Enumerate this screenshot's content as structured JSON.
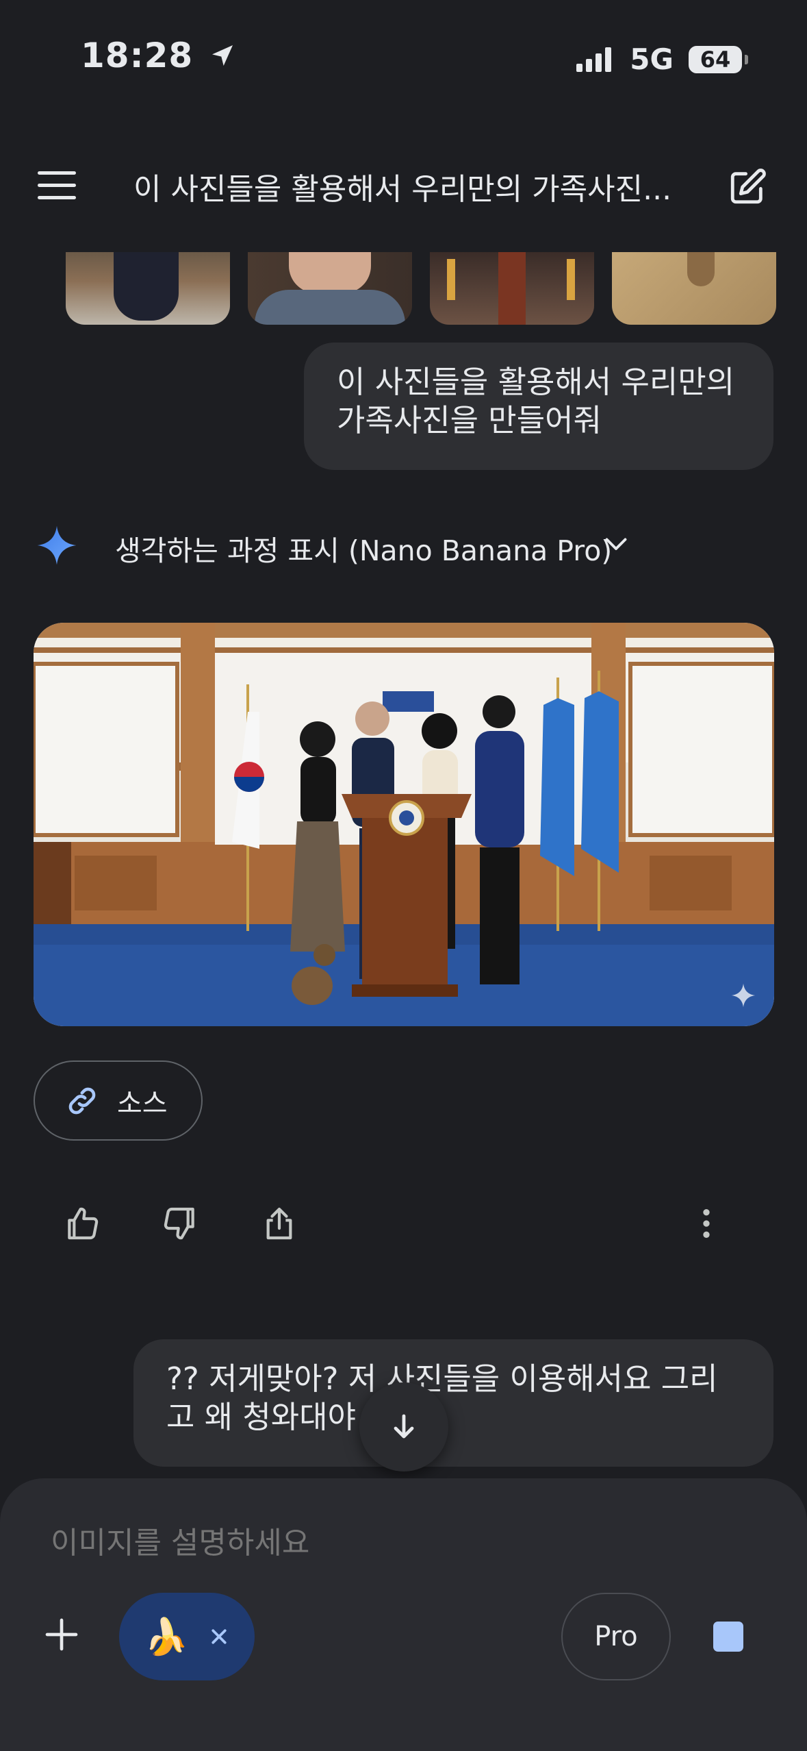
{
  "status_bar": {
    "time": "18:28",
    "network": "5G",
    "battery": "64"
  },
  "header": {
    "title": "이 사진들을 활용해서 우리만의 가족사진..."
  },
  "messages": {
    "user_1": "이 사진들을 활용해서 우리만의 가족사진을 만들어줘",
    "thinking_label": "생각하는 과정 표시 (Nano Banana Pro)",
    "source_label": "소스",
    "user_2": "?? 저게맞아? 저 사진들을 이용해서요 그리고 왜 청와대야"
  },
  "input": {
    "placeholder": "이미지를 설명하세요",
    "tool_chip_emoji": "🍌",
    "model_label": "Pro"
  },
  "colors": {
    "background": "#1d1e22",
    "bubble": "#2e2f33",
    "accent_blue": "#4c8df6",
    "chip_blue": "#1f3a70",
    "stop_blue": "#a8c7fa"
  },
  "icons": [
    "location-arrow-icon",
    "signal-icon",
    "battery-icon",
    "menu-icon",
    "edit-icon",
    "spark-icon",
    "chevron-down-icon",
    "link-icon",
    "thumbs-up-icon",
    "thumbs-down-icon",
    "share-icon",
    "more-vertical-icon",
    "arrow-down-icon",
    "plus-icon",
    "close-icon",
    "stop-icon"
  ]
}
